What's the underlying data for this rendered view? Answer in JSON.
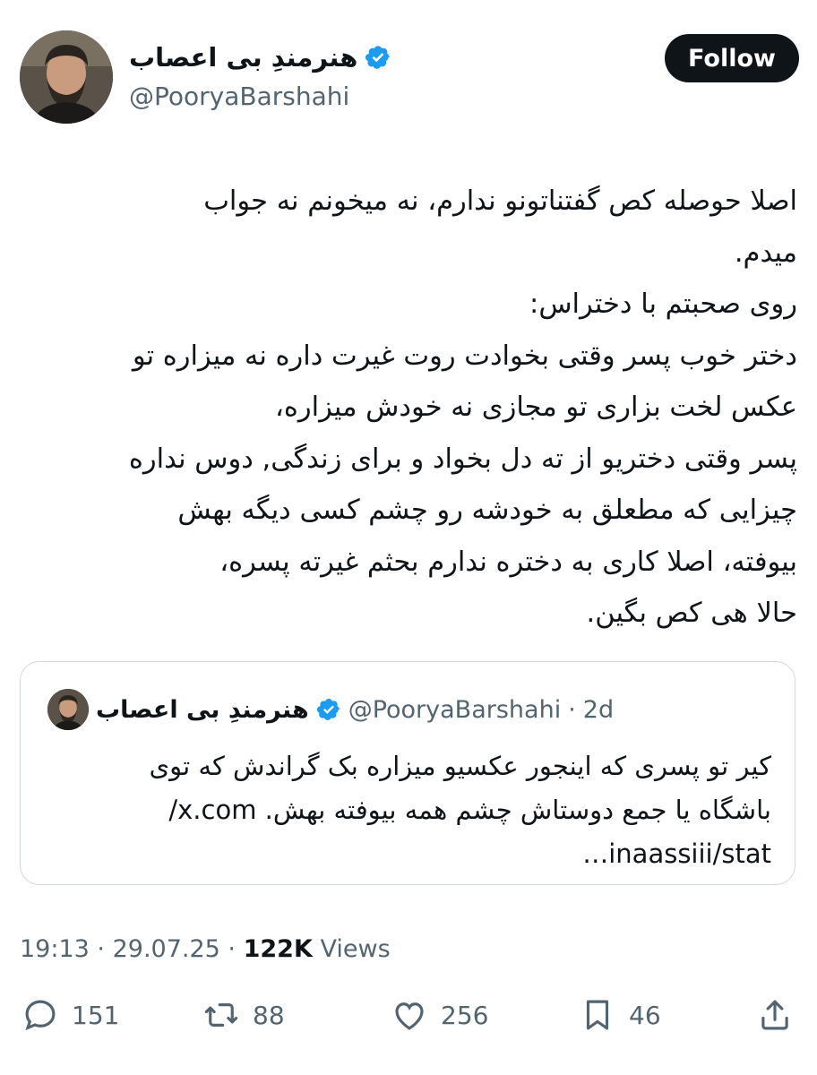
{
  "author": {
    "display_name": "هنرمندِ بی اعصاب",
    "handle": "@PooryaBarshahi",
    "verified": true,
    "avatar_icon": "profile-photo-man-beard"
  },
  "follow_label": "Follow",
  "tweet": {
    "text": "اصلا حوصله کص گفتناتونو ندارم، نه میخونم نه جواب\nمیدم.\nروی صحبتم با دختراس:\nدختر خوب پسر وقتی بخوادت روت غیرت داره نه میزاره تو\nعکس لخت بزاری تو مجازی نه خودش میزاره،\nپسر وقتی دختریو از ته دل بخواد و برای زندگی, دوس نداره\nچیزایی که مطعلق به خودشه رو چشم کسی دیگه بهش\nبیوفته، اصلا کاری به دختره ندارم بحثم غیرته پسره،\nحالا هی کص بگین."
  },
  "quote": {
    "display_name": "هنرمندِ بی اعصاب",
    "handle": "@PooryaBarshahi",
    "separator": "·",
    "time": "2d",
    "text": "کیر تو پسری که اینجور عکسیو میزاره بک گراندش که توی\nباشگاه یا جمع دوستاش چشم همه بیوفته بهش. x.com/\ninaassiii/stat…"
  },
  "meta": {
    "time": "19:13",
    "date": "29.07.25",
    "separator": "·",
    "views_count": "122K",
    "views_label": "Views"
  },
  "actions": {
    "replies": "151",
    "reposts": "88",
    "likes": "256",
    "bookmarks": "46"
  },
  "colors": {
    "text": "#0f1419",
    "secondary": "#536471",
    "verified_blue": "#1d9bf0",
    "border": "#cfd9de",
    "follow_bg": "#0f1419"
  }
}
